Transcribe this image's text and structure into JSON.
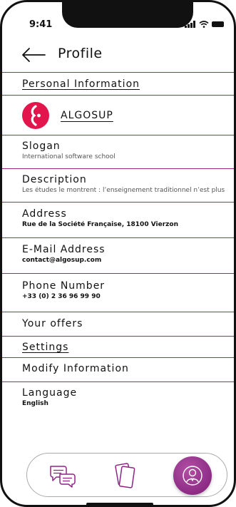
{
  "status_bar": {
    "time": "9:41"
  },
  "header": {
    "title": "Profile"
  },
  "sections": {
    "personal_information": "Personal Information",
    "settings": "Settings"
  },
  "brand": {
    "name": "ALGOSUP"
  },
  "fields": {
    "slogan": {
      "label": "Slogan",
      "value": "International software school"
    },
    "description": {
      "label": "Description",
      "value": "Les études le montrent : l’enseignement traditionnel n’est plus"
    },
    "address": {
      "label": "Address",
      "value": "Rue de la Société Française, 18100 Vierzon"
    },
    "email": {
      "label": "E-Mail Address",
      "value": "contact@algosup.com"
    },
    "phone": {
      "label": "Phone Number",
      "value": "+33 (0) 2 36 96 99 90"
    },
    "language": {
      "label": "Language",
      "value": "English"
    }
  },
  "menu": {
    "your_offers": "Your offers",
    "modify_information": "Modify Information"
  },
  "tabbar": {
    "items": [
      {
        "icon": "chat-bubbles-icon"
      },
      {
        "icon": "cards-icon"
      },
      {
        "icon": "profile-icon",
        "active": true
      }
    ]
  },
  "colors": {
    "accent": "#a0287c",
    "brand_logo": "#e2154d",
    "active_tab": "#8e2485"
  }
}
